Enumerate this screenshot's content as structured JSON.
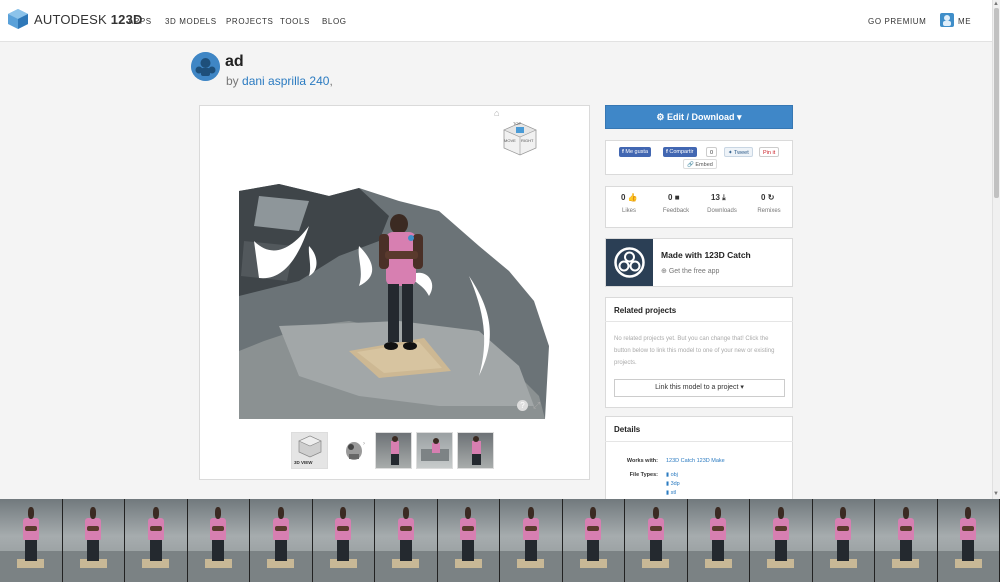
{
  "header": {
    "brand_prefix": "AUTODESK",
    "brand_suffix": "123D",
    "nav": [
      "APPS",
      "3D MODELS",
      "PROJECTS",
      "TOOLS",
      "BLOG"
    ],
    "go_premium": "GO PREMIUM",
    "user_label": "ME"
  },
  "project": {
    "title": "ad",
    "by_prefix": "by",
    "author": "dani asprilla 240",
    "author_suffix": ","
  },
  "viewer": {
    "cube_top": "TOP",
    "cube_left": "MOVE",
    "cube_right": "RIGHT",
    "help": "?",
    "thumb_3d_label": "3D VIEW"
  },
  "actions": {
    "edit_download": "Edit / Download",
    "social": {
      "like": "Me gusta",
      "share": "Compartir",
      "share_count": "0",
      "tweet": "Tweet",
      "pin": "Pin it",
      "embed": "Embed"
    }
  },
  "stats": [
    {
      "value": "0",
      "label": "Likes",
      "icon": "thumbs-up-icon"
    },
    {
      "value": "0",
      "label": "Feedback",
      "icon": "comment-icon"
    },
    {
      "value": "13",
      "label": "Downloads",
      "icon": "download-icon"
    },
    {
      "value": "0",
      "label": "Remixes",
      "icon": "remix-icon"
    }
  ],
  "catch": {
    "title": "Made with 123D Catch",
    "subtitle": "Get the free app"
  },
  "related": {
    "heading": "Related projects",
    "body": "No related projects yet. But you can change that! Click the button below to link this model to one of your new or existing projects.",
    "link_button": "Link this model to a project"
  },
  "details": {
    "heading": "Details",
    "works_with_label": "Works with:",
    "works_with_value": "123D Catch 123D Make",
    "file_types_label": "File Types:",
    "file_types": [
      "obj",
      "3dp",
      "stl"
    ]
  },
  "colors": {
    "accent": "#3f87c8",
    "link": "#2b7bc1",
    "shirt": "#d77fb1"
  }
}
